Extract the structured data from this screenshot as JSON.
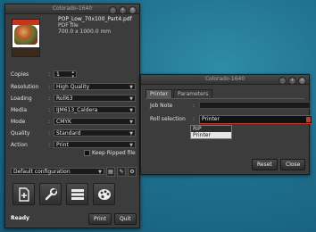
{
  "left_window": {
    "title": "Colorado-1640",
    "file": {
      "name": "POP_Low_70x100_Part4.pdf",
      "type": "PDF file",
      "size": "700.0 x 1000.0 mm"
    },
    "fields": [
      {
        "label": "Copies",
        "value": "1"
      },
      {
        "label": "Resolution",
        "value": "High Quality"
      },
      {
        "label": "Loading",
        "value": "Roll63"
      },
      {
        "label": "Media",
        "value": "IJM613_Caldera"
      },
      {
        "label": "Mode",
        "value": "CMYK"
      },
      {
        "label": "Quality",
        "value": "Standard"
      },
      {
        "label": "Action",
        "value": "Print"
      }
    ],
    "keep_ripped_label": "Keep Ripped file",
    "configuration": "Default configuration",
    "status": "Ready",
    "print_label": "Print",
    "quit_label": "Quit"
  },
  "right_window": {
    "title": "Colorado-1640",
    "tabs": [
      "Printer",
      "Parameters"
    ],
    "job_note_label": "Job Note",
    "roll_selection_label": "Roll selection",
    "roll_selection_value": "Printer",
    "roll_options": [
      "RIP",
      "Printer"
    ],
    "reset_label": "Reset",
    "close_label": "Close"
  },
  "colors": {
    "desktop": "#1f6f8e",
    "window_bg": "#3c3c3c",
    "highlight_border": "#c0392b"
  },
  "icons": [
    "file-plus-icon",
    "wrench-icon",
    "list-icon",
    "palette-icon"
  ]
}
